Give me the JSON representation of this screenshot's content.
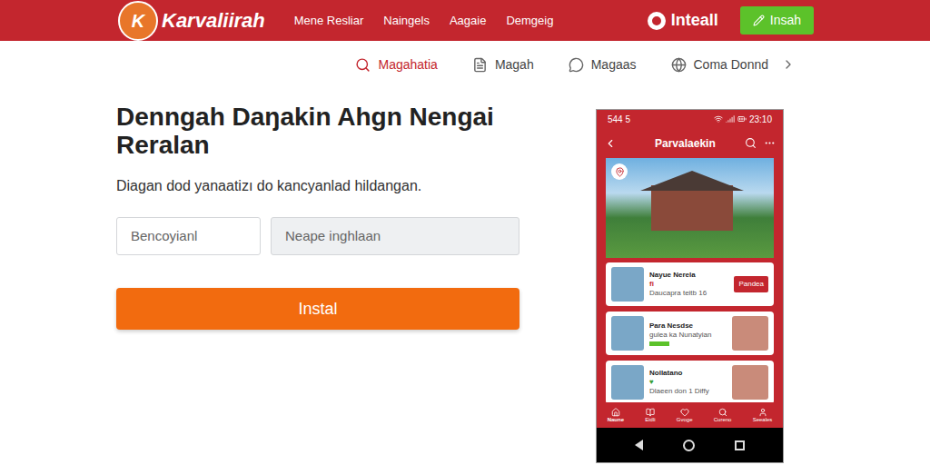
{
  "header": {
    "logo_mark": "K",
    "logo": "Karvaliirah",
    "nav": [
      "Mene Resliar",
      "Naingels",
      "Aagaie",
      "Demgeig"
    ],
    "account": "Inteall",
    "action": "Insah"
  },
  "subnav": [
    {
      "label": "Magahatia",
      "selected": true
    },
    {
      "label": "Magah",
      "selected": false
    },
    {
      "label": "Magaas",
      "selected": false
    },
    {
      "label": "Coma Donnd",
      "selected": false
    }
  ],
  "hero": {
    "title": "Denngah Daŋakin Ahgn Nengai Reralan",
    "subtitle": "Diagan dod yanaatizı do kancyanlad hildangan.",
    "fields": [
      {
        "placeholder": "Bencoyianl"
      },
      {
        "placeholder": "Neape inghlaan"
      }
    ],
    "button": "Instal"
  },
  "phone": {
    "status": {
      "left": "544 5",
      "time": "23:10"
    },
    "title": "Parvalaekin",
    "cards": [
      {
        "kind": "action",
        "name": "Nayue Nerela",
        "tag": "fi",
        "meta": "Daucapra teitb 16",
        "action": "Pandea"
      },
      {
        "kind": "photo",
        "name": "Para Nesdse",
        "tag": "",
        "meta": "gulea ka Nunatyian",
        "action": ""
      },
      {
        "kind": "double",
        "name": "Nollatano",
        "tag": "♥",
        "meta": "Dlaeen don 1 Diffy",
        "action": ""
      }
    ],
    "tabs": [
      {
        "label": "Naune",
        "selected": true
      },
      {
        "label": "Eidli",
        "selected": false
      },
      {
        "label": "Gvoge",
        "selected": false
      },
      {
        "label": "Cureno",
        "selected": false
      },
      {
        "label": "Seeales",
        "selected": false
      }
    ]
  }
}
